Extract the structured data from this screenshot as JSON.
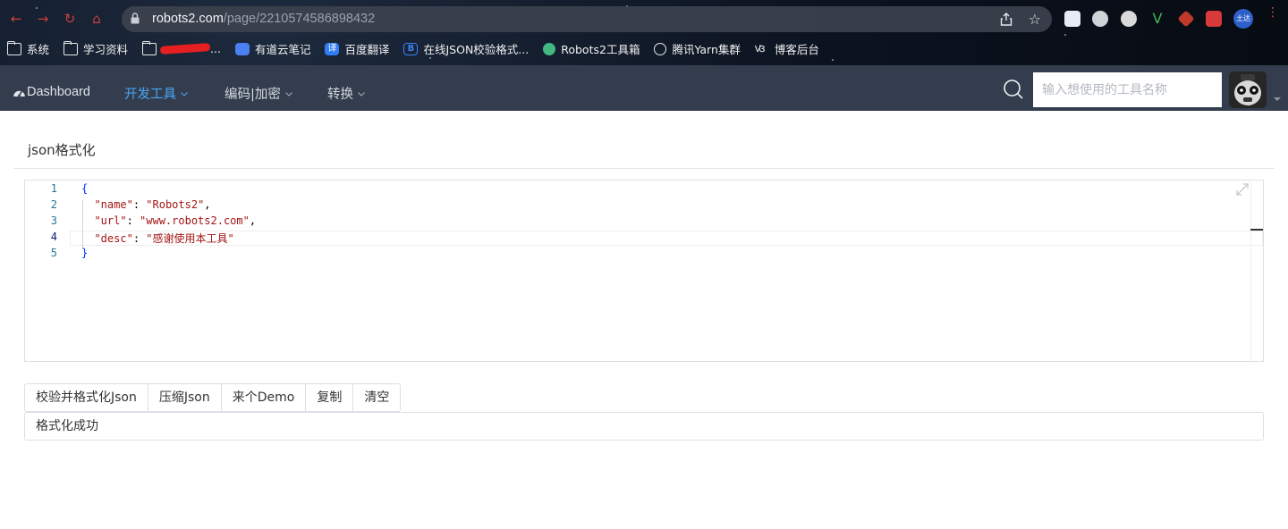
{
  "browser": {
    "url_domain": "robots2.com",
    "url_path": "/page/2210574586898432",
    "bookmarks": [
      {
        "label": "系统",
        "icon": "folder-icon"
      },
      {
        "label": "学习资料",
        "icon": "folder-icon"
      },
      {
        "label": "",
        "icon": "folder-icon",
        "redacted": true
      },
      {
        "label": "有道云笔记",
        "icon": "youdao-note-icon",
        "color": "#4a80f0"
      },
      {
        "label": "百度翻译",
        "icon": "baidu-translate-icon",
        "color": "#2f7ef5"
      },
      {
        "label": "在线JSON校验格式...",
        "icon": "bejson-icon",
        "color": "#3b82f6"
      },
      {
        "label": "Robots2工具箱",
        "icon": "vue-icon",
        "color": "#42b883"
      },
      {
        "label": "腾讯Yarn集群",
        "icon": "globe-icon"
      },
      {
        "label": "博客后台",
        "icon": "blog-icon"
      }
    ],
    "profile_badge": "土达"
  },
  "navbar": {
    "brand": "Dashboard",
    "items": [
      {
        "label": "开发工具",
        "active": true
      },
      {
        "label": "编码|加密",
        "active": false
      },
      {
        "label": "转换",
        "active": false
      }
    ],
    "search_placeholder": "输入想使用的工具名称",
    "active_color": "#4ba5f5"
  },
  "page": {
    "title": "json格式化"
  },
  "editor": {
    "line_numbers": [
      "1",
      "2",
      "3",
      "4",
      "5"
    ],
    "current_line": 4,
    "lines": [
      {
        "indent": "",
        "key": "",
        "value": "",
        "text": "{"
      },
      {
        "indent": "  ",
        "key": "\"name\"",
        "value": "\"Robots2\"",
        "trail": ","
      },
      {
        "indent": "  ",
        "key": "\"url\"",
        "value": "\"www.robots2.com\"",
        "trail": ","
      },
      {
        "indent": "  ",
        "key": "\"desc\"",
        "value": "\"感谢使用本工具\"",
        "trail": ""
      },
      {
        "indent": "",
        "key": "",
        "value": "",
        "text": "}"
      }
    ]
  },
  "actions": {
    "validate": "校验并格式化Json",
    "compress": "压缩Json",
    "demo": "来个Demo",
    "copy": "复制",
    "clear": "清空"
  },
  "result": {
    "message": "格式化成功"
  }
}
